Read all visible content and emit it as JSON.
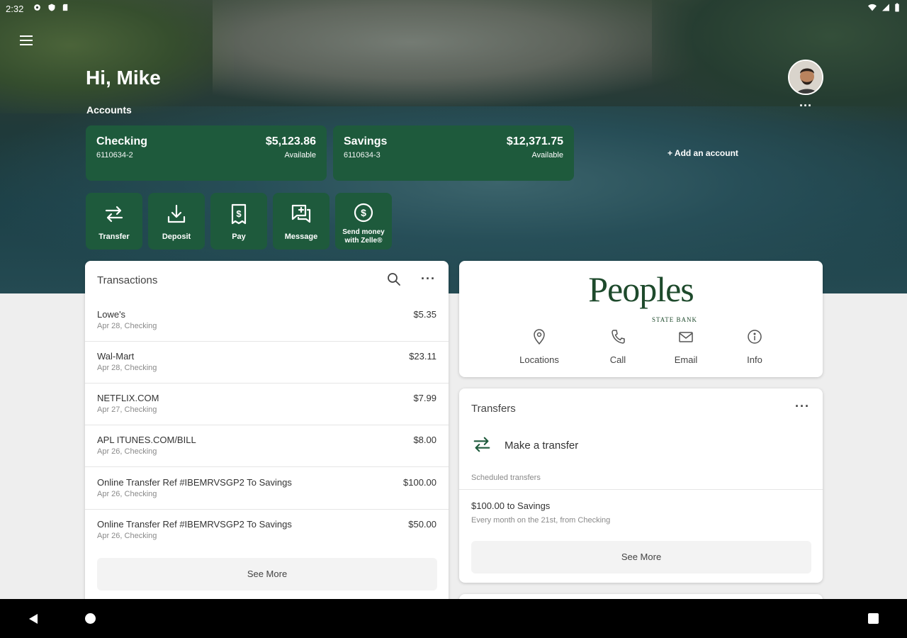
{
  "status_bar": {
    "time": "2:32"
  },
  "header": {
    "greeting": "Hi, Mike",
    "accounts_label": "Accounts",
    "add_account": "+ Add an account"
  },
  "accounts": [
    {
      "name": "Checking",
      "number": "6110634-2",
      "balance": "$5,123.86",
      "balance_label": "Available"
    },
    {
      "name": "Savings",
      "number": "6110634-3",
      "balance": "$12,371.75",
      "balance_label": "Available"
    }
  ],
  "quick_actions": [
    {
      "label": "Transfer",
      "icon": "transfer-icon"
    },
    {
      "label": "Deposit",
      "icon": "deposit-icon"
    },
    {
      "label": "Pay",
      "icon": "pay-icon"
    },
    {
      "label": "Message",
      "icon": "message-icon"
    },
    {
      "label": "Send money with Zelle®",
      "icon": "zelle-icon"
    }
  ],
  "transactions": {
    "title": "Transactions",
    "see_more": "See More",
    "rows": [
      {
        "name": "Lowe's",
        "detail": "Apr 28, Checking",
        "amount": "$5.35"
      },
      {
        "name": "Wal-Mart",
        "detail": "Apr 28, Checking",
        "amount": "$23.11"
      },
      {
        "name": "NETFLIX.COM",
        "detail": "Apr 27, Checking",
        "amount": "$7.99"
      },
      {
        "name": "APL ITUNES.COM/BILL",
        "detail": "Apr 26, Checking",
        "amount": "$8.00"
      },
      {
        "name": "Online Transfer Ref #IBEMRVSGP2 To Savings",
        "detail": "Apr 26, Checking",
        "amount": "$100.00"
      },
      {
        "name": "Online Transfer Ref #IBEMRVSGP2 To Savings",
        "detail": "Apr 26, Checking",
        "amount": "$50.00"
      }
    ]
  },
  "bank": {
    "logo_main": "Peoples",
    "logo_sub": "STATE BANK",
    "links": [
      {
        "label": "Locations",
        "icon": "location-pin-icon"
      },
      {
        "label": "Call",
        "icon": "phone-icon"
      },
      {
        "label": "Email",
        "icon": "email-icon"
      },
      {
        "label": "Info",
        "icon": "info-icon"
      }
    ]
  },
  "transfers": {
    "title": "Transfers",
    "make_transfer": "Make a transfer",
    "scheduled_label": "Scheduled transfers",
    "scheduled": [
      {
        "title": "$100.00 to Savings",
        "detail": "Every month on the 21st, from Checking"
      }
    ],
    "see_more": "See More"
  },
  "colors": {
    "brand_green": "#1e5a3c",
    "logo_green": "#1e4a2c"
  }
}
